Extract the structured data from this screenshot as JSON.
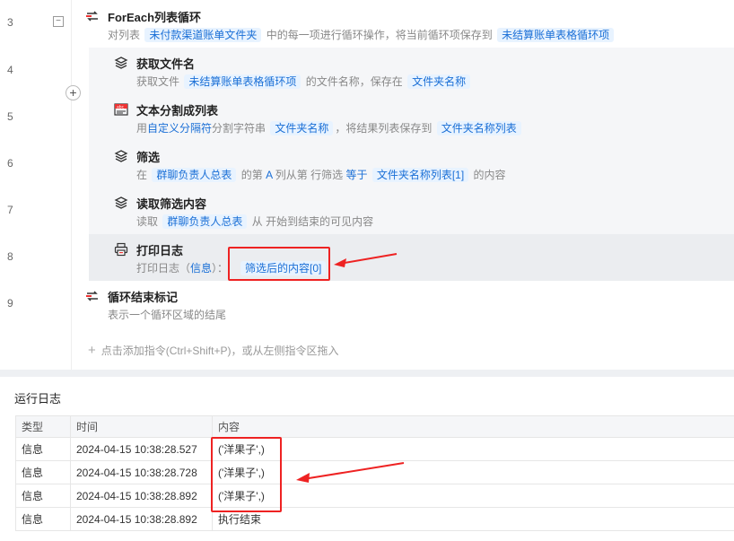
{
  "lines": [
    "3",
    "4",
    "5",
    "6",
    "7",
    "8",
    "9"
  ],
  "commands": {
    "foreach": {
      "title": "ForEach列表循环",
      "p1": "对列表",
      "t1": "未付款渠道账单文件夹",
      "p2": "中的每一项进行循环操作，将当前循环项保存到",
      "t2": "未结算账单表格循环项"
    },
    "getname": {
      "title": "获取文件名",
      "p1": "获取文件",
      "t1": "未结算账单表格循环项",
      "p2": "的文件名称，保存在",
      "t2": "文件夹名称"
    },
    "split": {
      "title": "文本分割成列表",
      "p1": "用",
      "h1": "自定义分隔符",
      "p2": "分割字符串",
      "t1": "文件夹名称",
      "p3": "，将结果列表保存到",
      "t2": "文件夹名称列表"
    },
    "filter": {
      "title": "筛选",
      "p1": "在",
      "t1": "群聊负责人总表",
      "p2": "的第",
      "h1": "A",
      "p3": "列从第",
      "p4": "行筛选",
      "h2": "等于",
      "t2": "文件夹名称列表[1]",
      "p5": "的内容"
    },
    "readfilter": {
      "title": "读取筛选内容",
      "p1": "读取",
      "t1": "群聊负责人总表",
      "p2": "从",
      "p3": "开始到结束的可见内容"
    },
    "printlog": {
      "title": "打印日志",
      "p1": "打印日志（",
      "h1": "信息",
      "p2": "）：",
      "t1": "筛选后的内容[0]"
    },
    "loopend": {
      "title": "循环结束标记",
      "desc": "表示一个循环区域的结尾"
    }
  },
  "add_hint": "点击添加指令(Ctrl+Shift+P)，或从左侧指令区拖入",
  "log": {
    "title": "运行日志",
    "headers": [
      "类型",
      "时间",
      "内容"
    ],
    "rows": [
      {
        "type": "信息",
        "time": "2024-04-15 10:38:28.527",
        "content": "('洋果子',)"
      },
      {
        "type": "信息",
        "time": "2024-04-15 10:38:28.728",
        "content": "('洋果子',)"
      },
      {
        "type": "信息",
        "time": "2024-04-15 10:38:28.892",
        "content": "('洋果子',)"
      },
      {
        "type": "信息",
        "time": "2024-04-15 10:38:28.892",
        "content": "执行结束"
      }
    ]
  },
  "colors": {
    "accent": "#1a6fd6",
    "annotation": "#e22222",
    "tag_bg": "#e8f3ff"
  },
  "icons": {
    "loop": "loop-icon",
    "layers": "layers-icon",
    "text_split": "text-split-icon",
    "printer": "printer-icon"
  }
}
